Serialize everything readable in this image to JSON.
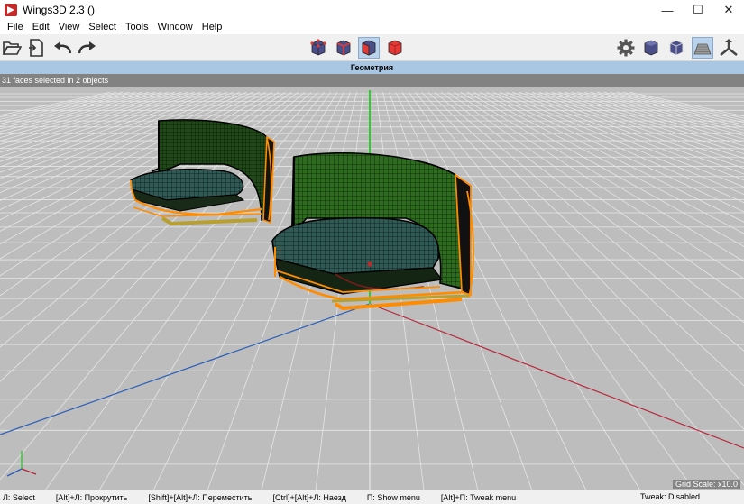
{
  "window": {
    "title": "Wings3D 2.3 ()",
    "minimize": "—",
    "maximize": "☐",
    "close": "✕"
  },
  "menu": [
    "File",
    "Edit",
    "View",
    "Select",
    "Tools",
    "Window",
    "Help"
  ],
  "toolbar": {
    "left": [
      "open-icon",
      "save-icon",
      "undo-icon",
      "redo-icon"
    ],
    "center": [
      "vertex-select-icon",
      "edge-select-icon",
      "face-select-icon",
      "object-select-icon"
    ],
    "right": [
      "settings-icon",
      "smooth-view-icon",
      "wireframe-view-icon",
      "ground-plane-icon",
      "axes-icon"
    ]
  },
  "geometry": {
    "title": "Геометрия"
  },
  "viewport": {
    "info": "31 faces selected in 2 objects",
    "grid_scale": "Grid Scale: x10.0"
  },
  "statusbar": {
    "items": [
      "Л: Select",
      "[Alt]+Л: Прокрутить",
      "[Shift]+[Alt]+Л: Переместить",
      "[Ctrl]+[Alt]+Л: Наезд",
      "П: Show menu",
      "[Alt]+П: Tweak menu"
    ],
    "tweak": "Tweak: Disabled"
  },
  "colors": {
    "selection_face": "#2d6b1f",
    "wire": "#000000",
    "edge": "#ff8c00",
    "header": "#a9c6e3"
  }
}
